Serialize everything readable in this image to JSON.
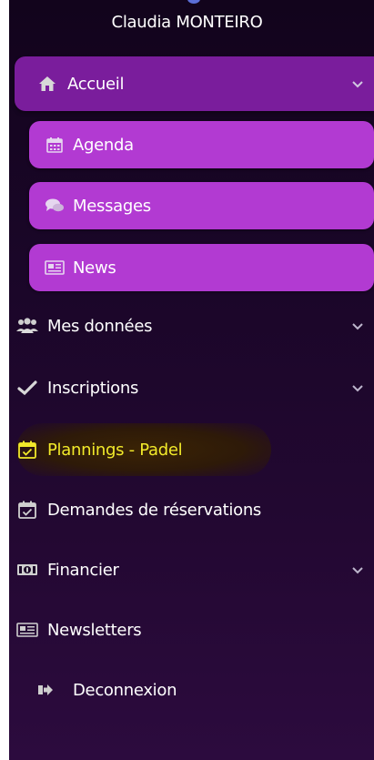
{
  "user": {
    "name": "Claudia MONTEIRO"
  },
  "menu": {
    "accueil": {
      "label": "Accueil",
      "icon": "home-icon"
    },
    "submenu": [
      {
        "label": "Agenda",
        "icon": "calendar-icon"
      },
      {
        "label": "Messages",
        "icon": "chat-icon"
      },
      {
        "label": "News",
        "icon": "newspaper-icon"
      }
    ],
    "items": [
      {
        "label": "Mes données",
        "icon": "users-icon",
        "expandable": true
      },
      {
        "label": "Inscriptions",
        "icon": "check-icon",
        "expandable": true
      },
      {
        "label": "Plannings - Padel",
        "icon": "calendar-check-icon",
        "expandable": false,
        "highlighted": true
      },
      {
        "label": "Demandes de réservations",
        "icon": "calendar-check-icon",
        "expandable": false
      },
      {
        "label": "Financier",
        "icon": "money-icon",
        "expandable": true
      },
      {
        "label": "Newsletters",
        "icon": "newspaper-icon",
        "expandable": false
      },
      {
        "label": "Deconnexion",
        "icon": "sign-out-icon",
        "expandable": false
      }
    ]
  },
  "colors": {
    "accent": "#7a1d9c",
    "submenu": "#b23ad2",
    "highlight_text": "#f2ea2a",
    "text": "#ffffff",
    "icon": "#d8d8d8"
  }
}
